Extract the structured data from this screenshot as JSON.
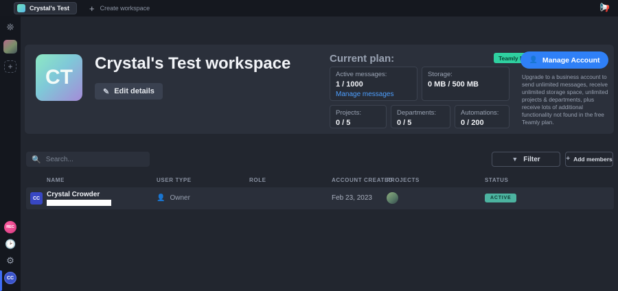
{
  "topbar": {
    "workspace_name": "Crystal's Test",
    "create_workspace_label": "Create workspace"
  },
  "rail": {
    "rec_badge": "REC",
    "user_initials": "CC"
  },
  "workspace": {
    "initials": "CT",
    "title": "Crystal's Test workspace",
    "edit_details_label": "Edit details"
  },
  "plan": {
    "title": "Current plan:",
    "badge": "Teamly Free",
    "manage_account_label": "Manage Account",
    "upgrade_text": "Upgrade to a business account to send unlimited messages, receive unlimited storage space, unlimited projects & departments, plus receive lots of additional functionality not found in the free Teamly plan.",
    "stats": [
      {
        "label": "Active messages:",
        "value": "1 / 1000",
        "link": "Manage messages"
      },
      {
        "label": "Storage:",
        "value": "0 MB / 500 MB"
      },
      {
        "label": "Projects:",
        "value": "0 / 5"
      },
      {
        "label": "Departments:",
        "value": "0 / 5"
      },
      {
        "label": "Automations:",
        "value": "0 / 200"
      }
    ]
  },
  "members": {
    "search_placeholder": "Search...",
    "filter_label": "Filter",
    "add_members_label": "Add members",
    "columns": [
      "NAME",
      "USER TYPE",
      "ROLE",
      "ACCOUNT CREATED",
      "PROJECTS",
      "STATUS"
    ],
    "rows": [
      {
        "initials": "CC",
        "name": "Crystal Crowder",
        "user_type": "Owner",
        "role": "",
        "account_created": "Feb 23, 2023",
        "status": "ACTIVE"
      }
    ]
  },
  "colors": {
    "accent_blue": "#2f80f7",
    "plan_badge_green": "#2fd0a0",
    "status_teal": "#4cb3a0",
    "rec_pink": "#e0488c"
  }
}
